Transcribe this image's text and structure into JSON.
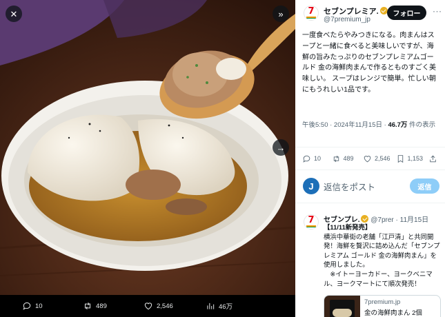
{
  "media": {
    "close_icon": "close-icon",
    "expand_icon": "double-chevron-right-icon",
    "next_icon": "arrow-right-icon",
    "stats": {
      "replies": "10",
      "retweets": "489",
      "likes": "2,546",
      "views": "46万"
    }
  },
  "tweet": {
    "author": {
      "name": "セブンプレミア.",
      "handle": "@7premium_jp",
      "avatar_text": "7"
    },
    "follow_label": "フォロー",
    "text": "一度食べたらやみつきになる。肉まんはスープと一緒に食べると美味しいですが、海鮮の旨みたっぷりのセブンプレミアムゴールド 金の海鮮肉まんで作るとものすごく美味しい。 スープはレンジで簡単。忙しい朝にもうれしい1品です。",
    "meta": {
      "time": "午後5:50 · 2024年11月15日 · ",
      "views": "46.7万",
      "views_suffix": " 件の表示"
    },
    "stats": {
      "replies": "10",
      "retweets": "489",
      "likes": "2,546",
      "bookmarks": "1,153"
    }
  },
  "reply_box": {
    "avatar_letter": "J",
    "placeholder": "返信をポスト",
    "button": "返信"
  },
  "reply": {
    "name": "セブンプレ.",
    "handle_time": " @7prer · 11月15日",
    "text_1": "【11/11新発売】",
    "text_2": "横浜中華街の老舗「江戸清」と共同開発！海鮮を贅沢に詰め込んだ「セブンプレミアム ゴールド 金の海鮮肉まん」を使用しました。",
    "text_3": "　※イトーヨーカドー、ヨークベニマル、ヨークマートにて順次発売！",
    "link": {
      "domain": "7premium.jp",
      "title": "金の海鮮肉まん 2個"
    }
  },
  "colors": {
    "accent": "#1d9bf0",
    "reply_button": "#8ecdf8",
    "verified": "#e8b021",
    "brand_red": "#e60012"
  }
}
